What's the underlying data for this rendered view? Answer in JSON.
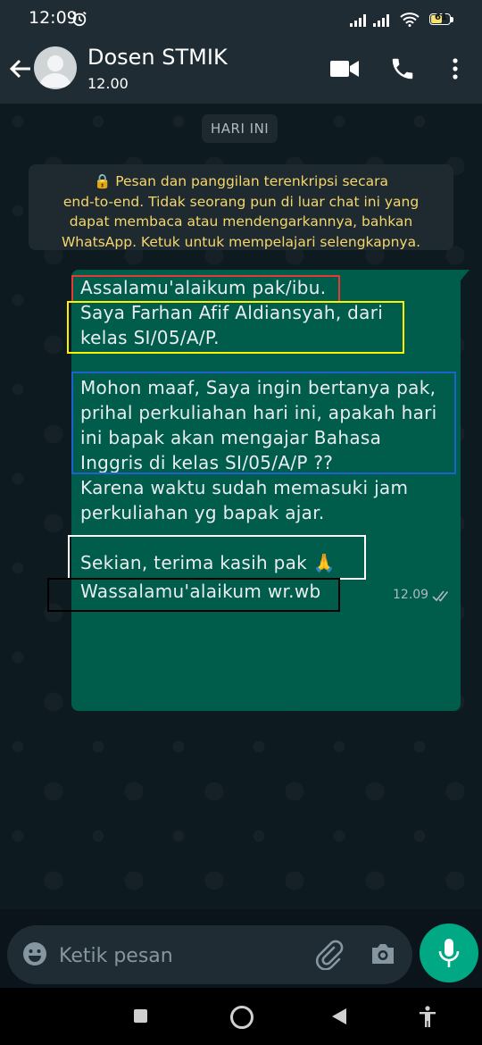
{
  "status_bar": {
    "time": "12:09",
    "battery": "61",
    "battery_level": 0.61
  },
  "header": {
    "name": "Dosen STMIK",
    "status": "12.00"
  },
  "chat": {
    "date_chip": "HARI INI",
    "encryption_lines": [
      "🔒 Pesan dan panggilan terenkripsi secara",
      "end-to-end. Tidak seorang pun di luar chat ini yang",
      "dapat membaca atau mendengarkannya, bahkan",
      "WhatsApp. Ketuk untuk mempelajari selengkapnya."
    ],
    "message": {
      "lines": [
        "Assalamu'alaikum pak/ibu.",
        "Saya Farhan Afif Aldiansyah, dari",
        "kelas SI/05/A/P.",
        "Mohon maaf, Saya ingin bertanya pak,",
        "prihal perkuliahan hari ini, apakah hari",
        "ini bapak akan mengajar Bahasa",
        "Inggris di kelas SI/05/A/P ??",
        "Karena waktu sudah memasuki jam",
        "perkuliahan yg bapak ajar.",
        "Sekian, terima kasih pak 🙏",
        "Wassalamu'alaikum wr.wb"
      ],
      "time": "12.09"
    }
  },
  "composer": {
    "placeholder": "Ketik pesan"
  },
  "colors": {
    "header": "#1f2c34",
    "bubble": "#005c4b",
    "accent": "#00a884",
    "notice_text": "#f5d66b",
    "highlight_red": "#e53935",
    "highlight_yellow": "#fff200",
    "highlight_blue": "#1e62d0",
    "highlight_white": "#ffffff",
    "highlight_black": "#000000"
  }
}
